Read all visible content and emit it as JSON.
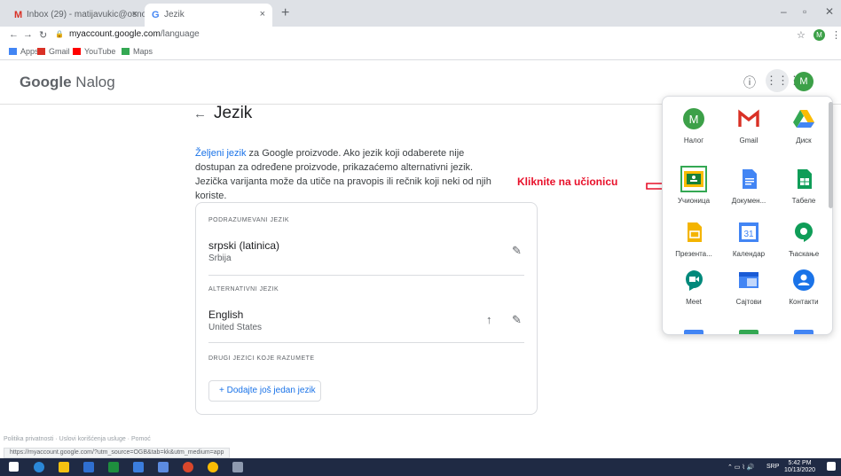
{
  "browser": {
    "tabs": [
      {
        "title": "Inbox (29) - matijavukic@osnov",
        "icon": "gmail-icon"
      },
      {
        "title": "Jezik",
        "icon": "google-icon"
      }
    ],
    "url_host": "myaccount.google.com",
    "url_path": "/language",
    "bookmarks": [
      "Apps",
      "Gmail",
      "YouTube",
      "Maps"
    ]
  },
  "header": {
    "logo_google": "Google",
    "logo_product": "Nalog",
    "avatar_letter": "M"
  },
  "page": {
    "title": "Jezik",
    "intro_link": "Željeni jezik",
    "intro_text": " za Google proizvode. Ako jezik koji odaberete nije dostupan za određene proizvode, prikazaćemo alternativni jezik. Jezička varijanta može da utiče na pravopis ili rečnik koji neki od njih koriste.",
    "default_section": "PODRAZUMEVANI JEZIK",
    "default_language": "srpski (latinica)",
    "default_region": "Srbija",
    "alt_section": "ALTERNATIVNI JEZIK",
    "alt_language": "English",
    "alt_region": "United States",
    "other_section": "DRUGI JEZICI KOJE RAZUMETE",
    "add_button": "+ Dodajte još jedan jezik"
  },
  "annotation": {
    "text": "Kliknite na učionicu",
    "color": "#e8102a"
  },
  "apps": [
    {
      "label": "Налог",
      "icon": "account-icon"
    },
    {
      "label": "Gmail",
      "icon": "gmail-icon"
    },
    {
      "label": "Диск",
      "icon": "drive-icon"
    },
    {
      "label": "Учионица",
      "icon": "classroom-icon"
    },
    {
      "label": "Докумен...",
      "icon": "docs-icon"
    },
    {
      "label": "Табеле",
      "icon": "sheets-icon"
    },
    {
      "label": "Презента...",
      "icon": "slides-icon"
    },
    {
      "label": "Календар",
      "icon": "calendar-icon"
    },
    {
      "label": "Ћаскање",
      "icon": "hangouts-icon"
    },
    {
      "label": "Meet",
      "icon": "meet-icon"
    },
    {
      "label": "Сајтови",
      "icon": "sites-icon"
    },
    {
      "label": "Контакти",
      "icon": "contacts-icon"
    }
  ],
  "calendar_day": "31",
  "footer": {
    "links": "Politika privatnosti · Uslovi korišćenja usluge · Pomoć",
    "status_url": "https://myaccount.google.com/?utm_source=OGB&tab=kk&utm_medium=app"
  },
  "taskbar": {
    "tray_text": "SRP",
    "time": "5:42 PM",
    "date": "10/13/2020"
  },
  "colors": {
    "google_blue": "#1a73e8",
    "avatar_green": "#3ca048",
    "taskbar": "#1f2a44"
  }
}
